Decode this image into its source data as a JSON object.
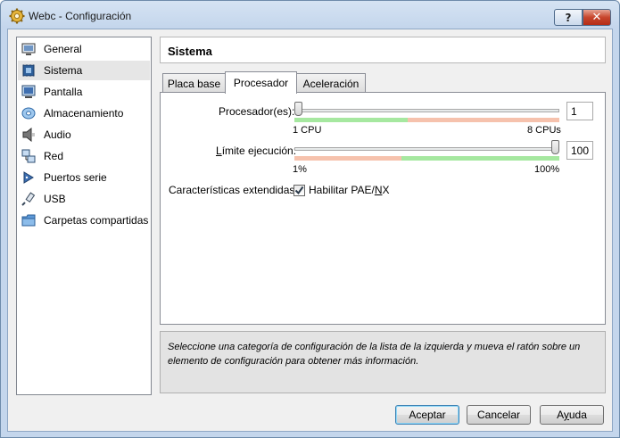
{
  "window": {
    "title": "Webc - Configuración",
    "help_button": "?",
    "close_button": "✕"
  },
  "sidebar": {
    "items": [
      {
        "label": "General",
        "icon": "monitor-icon"
      },
      {
        "label": "Sistema",
        "icon": "chip-icon",
        "selected": true
      },
      {
        "label": "Pantalla",
        "icon": "display-icon"
      },
      {
        "label": "Almacenamiento",
        "icon": "disk-icon"
      },
      {
        "label": "Audio",
        "icon": "speaker-icon"
      },
      {
        "label": "Red",
        "icon": "network-icon"
      },
      {
        "label": "Puertos serie",
        "icon": "serial-port-icon"
      },
      {
        "label": "USB",
        "icon": "usb-icon"
      },
      {
        "label": "Carpetas compartidas",
        "icon": "folder-icon"
      }
    ]
  },
  "header": {
    "title": "Sistema"
  },
  "tabs": [
    {
      "label": "Placa base",
      "active": false
    },
    {
      "label": "Procesador",
      "active": true
    },
    {
      "label": "Aceleración",
      "active": false
    }
  ],
  "processor": {
    "label": "Procesador(es):",
    "value": "1",
    "fraction": 0.0,
    "min_label": "1 CPU",
    "max_label": "8 CPUs"
  },
  "exec_cap": {
    "label": "Límite ejecución:",
    "value": "100",
    "fraction": 1.0,
    "min_label": "1%",
    "max_label": "100%"
  },
  "extended": {
    "label": "Características extendidas:",
    "checkbox_label": "Habilitar PAE/NX",
    "checked": true
  },
  "info_text": "Seleccione una categoría de configuración de la lista de la izquierda y mueva el ratón sobre un elemento de configuración para obtener más información.",
  "buttons": {
    "accept": "Aceptar",
    "cancel": "Cancelar",
    "help": "Ayuda"
  },
  "colors": {
    "zone_green": "#a6e8a0",
    "zone_red": "#f6c2ad",
    "accent": "#3c7fb1"
  }
}
